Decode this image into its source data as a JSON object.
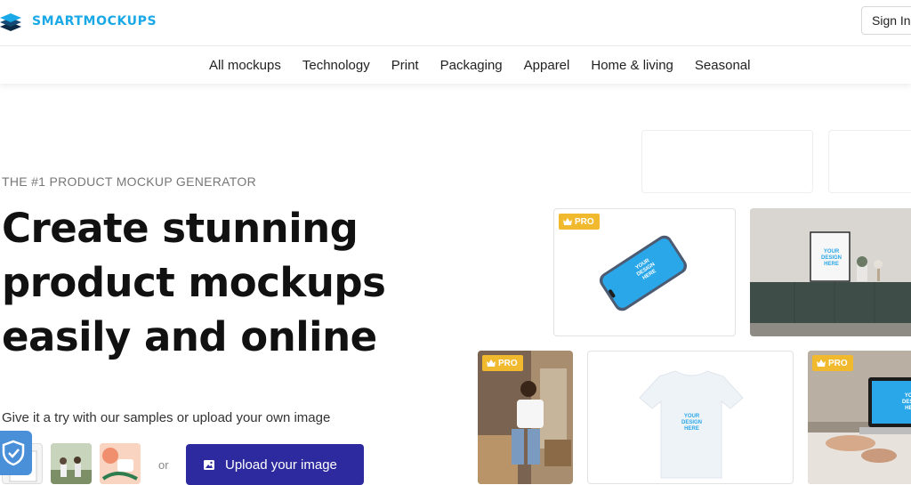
{
  "brand": {
    "name": "SMARTMOCKUPS",
    "color": "#1aa9e6"
  },
  "header": {
    "signin_label": "Sign In"
  },
  "nav": {
    "items": [
      "All mockups",
      "Technology",
      "Print",
      "Packaging",
      "Apparel",
      "Home & living",
      "Seasonal"
    ]
  },
  "hero": {
    "eyebrow": "THE #1 PRODUCT MOCKUP GENERATOR",
    "headline": [
      "Create stunning",
      "product mockups",
      "easily and online"
    ],
    "try_text": "Give it a try with our samples or upload your own image",
    "or_text": "or",
    "upload_label": "Upload your image",
    "upload_color": "#2c2a9e"
  },
  "badges": {
    "pro_label": "PRO",
    "pro_color": "#f1b92e"
  },
  "design_placeholder": [
    "YOUR",
    "DESIGN",
    "HERE"
  ]
}
